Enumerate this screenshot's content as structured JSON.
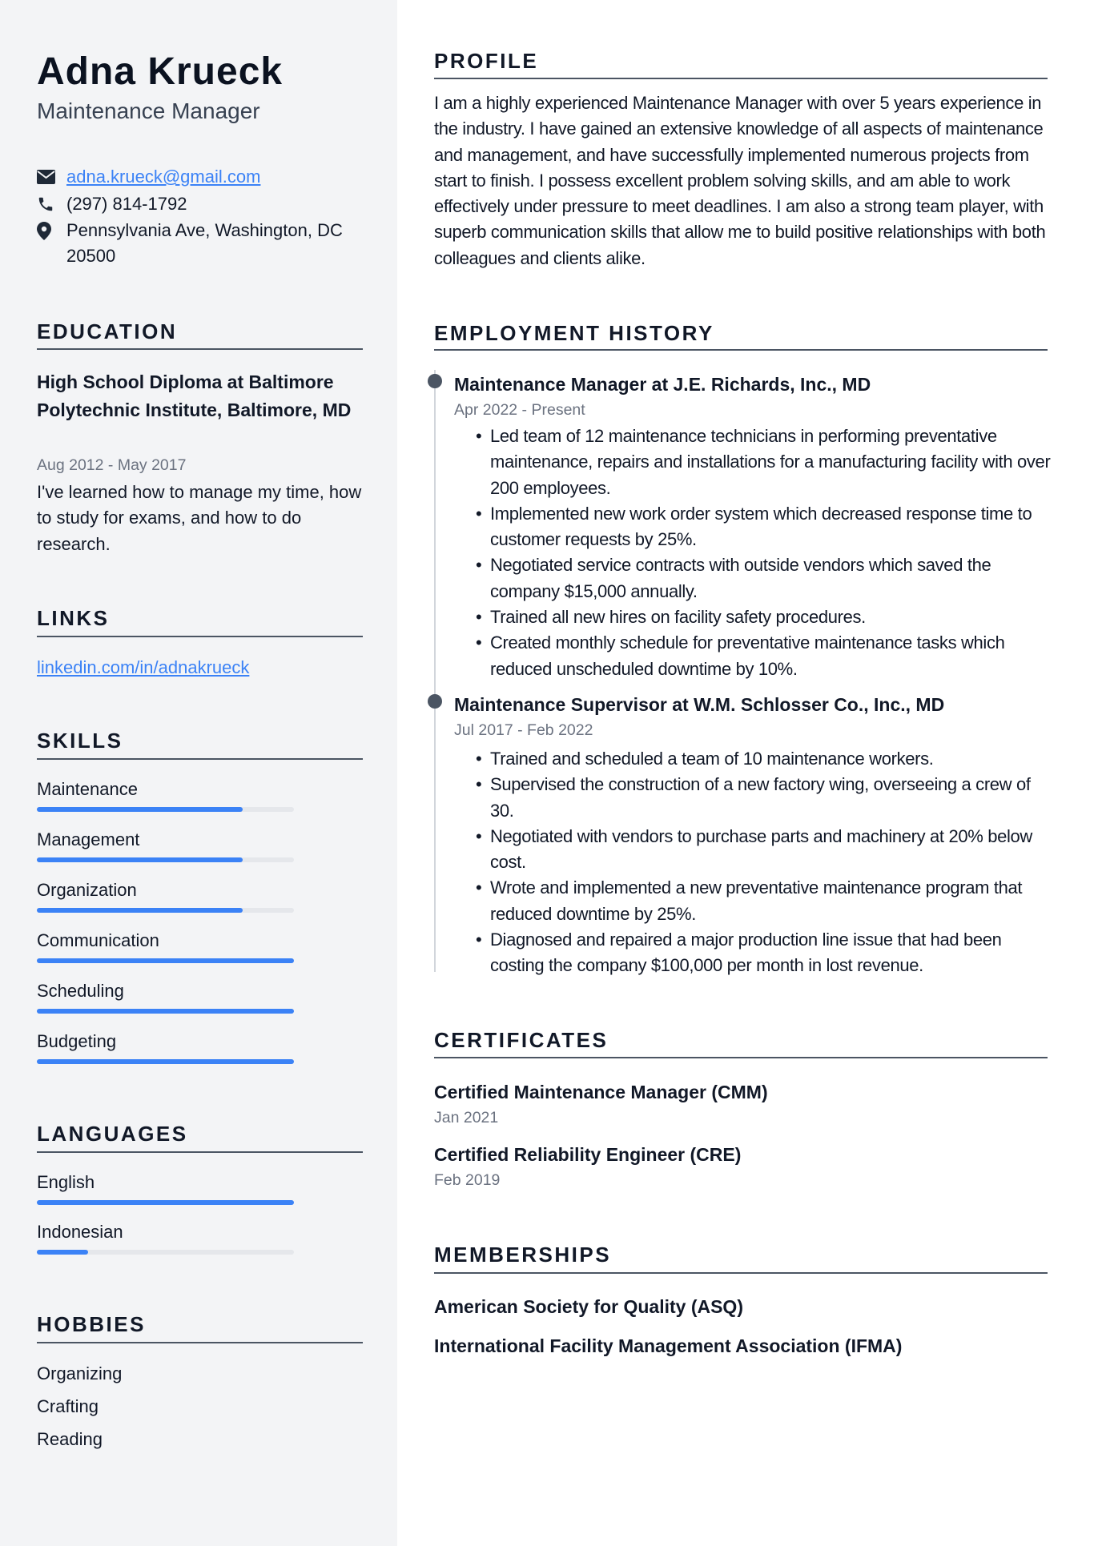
{
  "header": {
    "name": "Adna Krueck",
    "title": "Maintenance Manager"
  },
  "contact": {
    "email": "adna.krueck@gmail.com",
    "phone": "(297) 814-1792",
    "address_line1": "Pennsylvania Ave, Washington, DC",
    "address_line2": "20500",
    "icons": {
      "email": "envelope-icon",
      "phone": "phone-icon",
      "address": "map-pin-icon"
    }
  },
  "education": {
    "heading": "EDUCATION",
    "items": [
      {
        "title": "High School Diploma at Baltimore Polytechnic Institute, Baltimore, MD",
        "date": "Aug 2012 - May 2017",
        "description": "I've learned how to manage my time, how to study for exams, and how to do research."
      }
    ]
  },
  "links": {
    "heading": "LINKS",
    "items": [
      {
        "label": "linkedin.com/in/adnakrueck"
      }
    ]
  },
  "skills": {
    "heading": "SKILLS",
    "items": [
      {
        "label": "Maintenance",
        "level": 0.8
      },
      {
        "label": "Management",
        "level": 0.8
      },
      {
        "label": "Organization",
        "level": 0.8
      },
      {
        "label": "Communication",
        "level": 1.0
      },
      {
        "label": "Scheduling",
        "level": 1.0
      },
      {
        "label": "Budgeting",
        "level": 1.0
      }
    ]
  },
  "languages": {
    "heading": "LANGUAGES",
    "items": [
      {
        "label": "English",
        "level": 1.0
      },
      {
        "label": "Indonesian",
        "level": 0.2
      }
    ]
  },
  "hobbies": {
    "heading": "HOBBIES",
    "items": [
      "Organizing",
      "Crafting",
      "Reading"
    ]
  },
  "profile": {
    "heading": "PROFILE",
    "text": "I am a highly experienced Maintenance Manager with over 5 years experience in the industry. I have gained an extensive knowledge of all aspects of maintenance and management, and have successfully implemented numerous projects from start to finish. I possess excellent problem solving skills, and am able to work effectively under pressure to meet deadlines. I am also a strong team player, with superb communication skills that allow me to build positive relationships with both colleagues and clients alike."
  },
  "employment": {
    "heading": "EMPLOYMENT HISTORY",
    "jobs": [
      {
        "title": "Maintenance Manager at J.E. Richards, Inc., MD",
        "date": "Apr 2022 - Present",
        "bullets": [
          "Led team of 12 maintenance technicians in performing preventative maintenance, repairs and installations for a manufacturing facility with over 200 employees.",
          "Implemented new work order system which decreased response time to customer requests by 25%.",
          "Negotiated service contracts with outside vendors which saved the company $15,000 annually.",
          "Trained all new hires on facility safety procedures.",
          "Created monthly schedule for preventative maintenance tasks which reduced unscheduled downtime by 10%."
        ]
      },
      {
        "title": "Maintenance Supervisor at W.M. Schlosser Co., Inc., MD",
        "date": "Jul 2017 - Feb 2022",
        "bullets": [
          "Trained and scheduled a team of 10 maintenance workers.",
          "Supervised the construction of a new factory wing, overseeing a crew of 30.",
          "Negotiated with vendors to purchase parts and machinery at 20% below cost.",
          "Wrote and implemented a new preventative maintenance program that reduced downtime by 25%.",
          "Diagnosed and repaired a major production line issue that had been costing the company $100,000 per month in lost revenue."
        ]
      }
    ]
  },
  "certificates": {
    "heading": "CERTIFICATES",
    "items": [
      {
        "title": "Certified Maintenance Manager (CMM)",
        "date": "Jan 2021"
      },
      {
        "title": "Certified Reliability Engineer (CRE)",
        "date": "Feb 2019"
      }
    ]
  },
  "memberships": {
    "heading": "MEMBERSHIPS",
    "items": [
      "American Society for Quality (ASQ)",
      "International Facility Management Association (IFMA)"
    ]
  },
  "colors": {
    "accent": "#3b82f6",
    "sidebar_bg": "#f3f4f6",
    "heading_rule": "#4b5563",
    "muted_text": "#6b7280",
    "bar_track": "#e5e7eb"
  }
}
